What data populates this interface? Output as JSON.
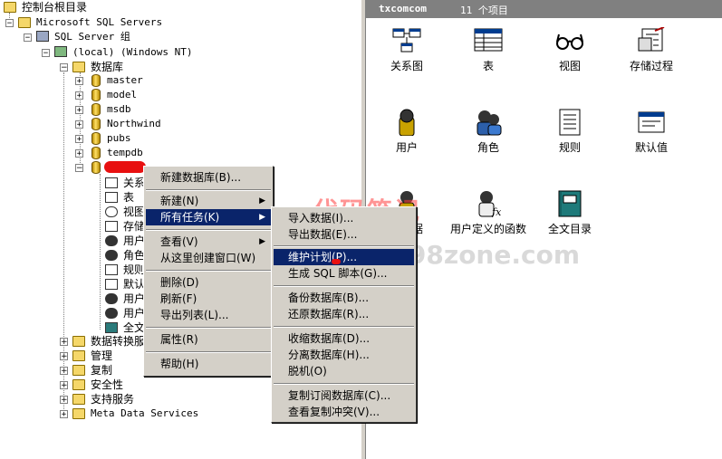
{
  "tree": {
    "root": "控制台根目录",
    "servers_group": "Microsoft SQL Servers",
    "server_group": "SQL Server 组",
    "server": "(local) (Windows NT)",
    "databases_folder": "数据库",
    "databases": [
      "master",
      "model",
      "msdb",
      "Northwind",
      "pubs",
      "tempdb"
    ],
    "db_children": [
      "关系",
      "表",
      "视图",
      "存储",
      "用户",
      "角色",
      "规则",
      "默认",
      "用户",
      "用户",
      "全文"
    ],
    "other_folders": [
      "数据转换服",
      "管理",
      "复制",
      "安全性",
      "支持服务",
      "Meta Data Services"
    ]
  },
  "right": {
    "header_name": "txcomcom",
    "header_count": "11 个项目",
    "items": [
      "关系图",
      "表",
      "视图",
      "存储过程",
      "用户",
      "角色",
      "规则",
      "默认值",
      "的数据",
      "用户定义的函数",
      "全文目录"
    ]
  },
  "context_menu": {
    "items": [
      "新建数据库(B)...",
      "新建(N)",
      "所有任务(K)",
      "查看(V)",
      "从这里创建窗口(W)",
      "删除(D)",
      "刷新(F)",
      "导出列表(L)...",
      "属性(R)",
      "帮助(H)"
    ]
  },
  "submenu": {
    "items": [
      "导入数据(I)...",
      "导出数据(E)...",
      "维护计划(P)...",
      "生成 SQL 脚本(G)...",
      "备份数据库(B)...",
      "还原数据库(R)...",
      "收缩数据库(D)...",
      "分离数据库(H)...",
      "脱机(O)",
      "复制订阅数据库(C)...",
      "查看复制冲突(V)..."
    ]
  },
  "watermark": {
    "title": "代码笔记",
    "domain": "www.198zone.com"
  },
  "colors": {
    "selection": "#0a246a",
    "menu_bg": "#d4d0c8",
    "redaction": "#e81010"
  }
}
